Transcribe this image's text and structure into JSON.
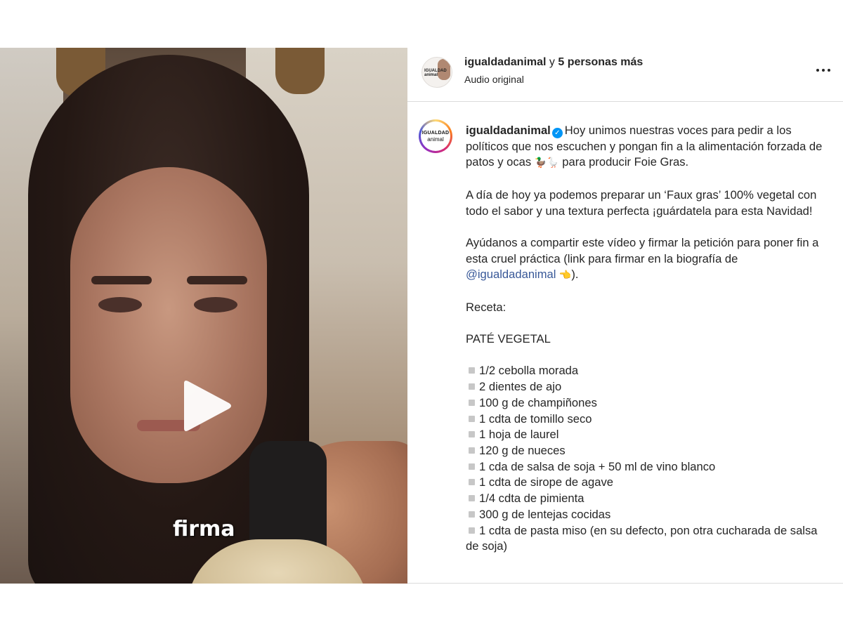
{
  "video": {
    "caption_word": "firma"
  },
  "header": {
    "username": "igualdadanimal",
    "connector": " y ",
    "more_people": "5 personas más",
    "subtitle": "Audio original",
    "avatar_logo_line1": "IGUALDAD",
    "avatar_logo_line2": "animal"
  },
  "post": {
    "avatar_logo_line1": "IGUALDAD",
    "avatar_logo_line2": "animal",
    "username": "igualdadanimal",
    "verified": true,
    "para1_text": "Hoy unimos nuestras voces para pedir a los políticos que nos escuchen y pongan fin a la alimentación forzada de patos y ocas ",
    "para1_emoji": "🦆🪿",
    "para1_end": " para producir Foie Gras.",
    "para2": "A día de hoy ya podemos preparar un ‘Faux gras’ 100% vegetal con todo el sabor y una textura perfecta ¡guárdatela para esta Navidad!",
    "para3_text": "Ayúdanos a compartir este vídeo y firmar la petición para poner fin a esta cruel práctica (link para firmar en la biografía de ",
    "para3_mention": "@igualdadanimal",
    "para3_emoji": " 👈",
    "para3_end": ").",
    "recipe_heading": "Receta:",
    "recipe_title": "PATÉ VEGETAL",
    "ingredients": [
      "1/2 cebolla morada",
      "2 dientes de ajo",
      "100 g de champiñones",
      "1 cdta de tomillo seco",
      "1 hoja de laurel",
      "120 g de nueces",
      "1 cda de salsa de soja + 50 ml de vino blanco",
      "1 cdta de sirope de agave",
      "1/4 cdta de pimienta",
      "300 g de lentejas cocidas",
      "1 cdta de pasta miso (en su defecto, pon otra cucharada de salsa de soja)"
    ]
  }
}
